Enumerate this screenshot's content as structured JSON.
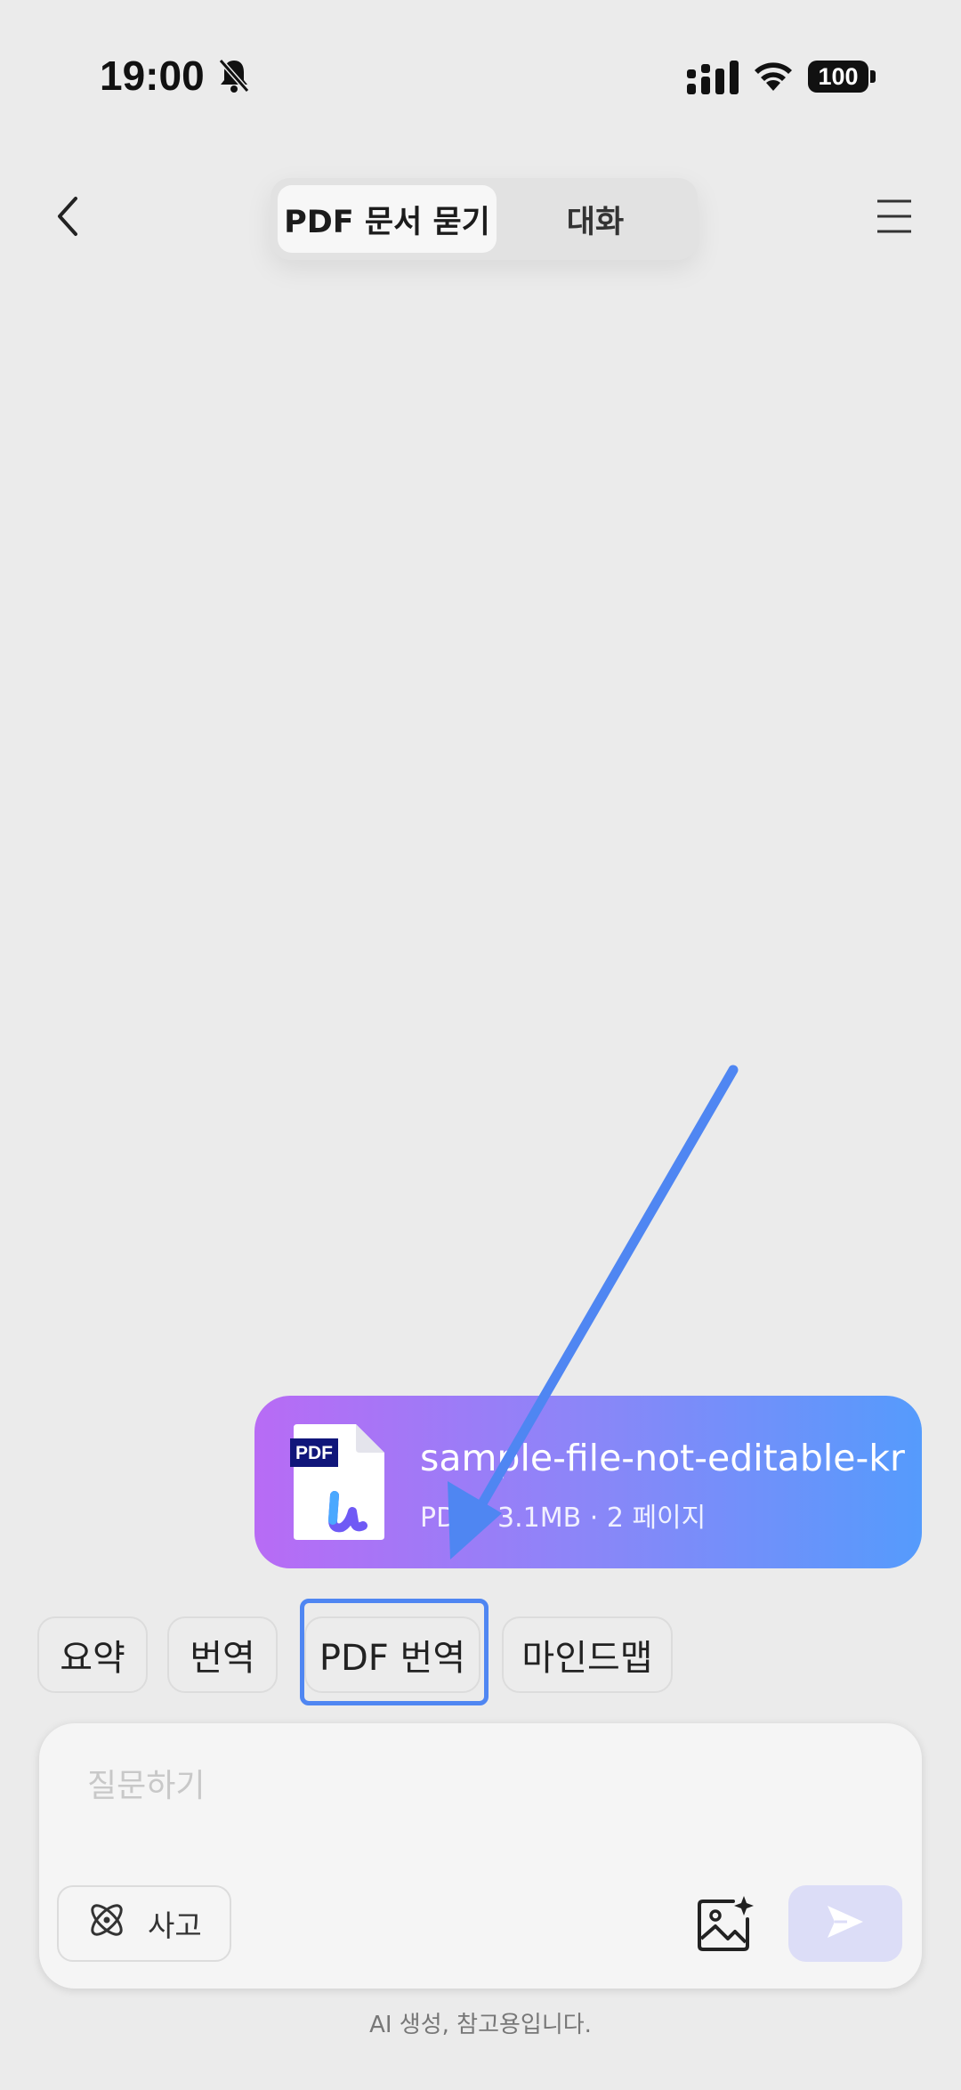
{
  "status_bar": {
    "time": "19:00",
    "battery": "100",
    "icons": [
      "bell-muted-icon",
      "signal-icon",
      "wifi-icon",
      "battery-icon"
    ]
  },
  "header": {
    "back_icon": "chevron-left-icon",
    "menu_icon": "hamburger-menu-icon",
    "tabs": [
      {
        "label": "PDF 문서 묻기",
        "active": true
      },
      {
        "label": "대화",
        "active": false
      }
    ]
  },
  "file_card": {
    "name": "sample-file-not-editable-kr",
    "meta": "PDF · 3.1MB · 2 페이지",
    "badge": "PDF",
    "colors": {
      "start": "#b86bf5",
      "end": "#559bfc"
    }
  },
  "quick_actions": [
    {
      "label": "요약"
    },
    {
      "label": "번역"
    },
    {
      "label": "PDF 번역",
      "highlighted": true
    },
    {
      "label": "마인드맵"
    }
  ],
  "composer": {
    "placeholder": "질문하기",
    "value": "",
    "think_label": "사고",
    "think_icon": "atom-icon",
    "image_icon": "image-sparkle-icon",
    "send_icon": "send-icon"
  },
  "footer": {
    "disclaimer": "AI 생성, 참고용입니다."
  },
  "accent_colors": {
    "highlight": "#4f86f2",
    "arrow": "#4f86f2",
    "send_bg": "#dcddf7"
  }
}
